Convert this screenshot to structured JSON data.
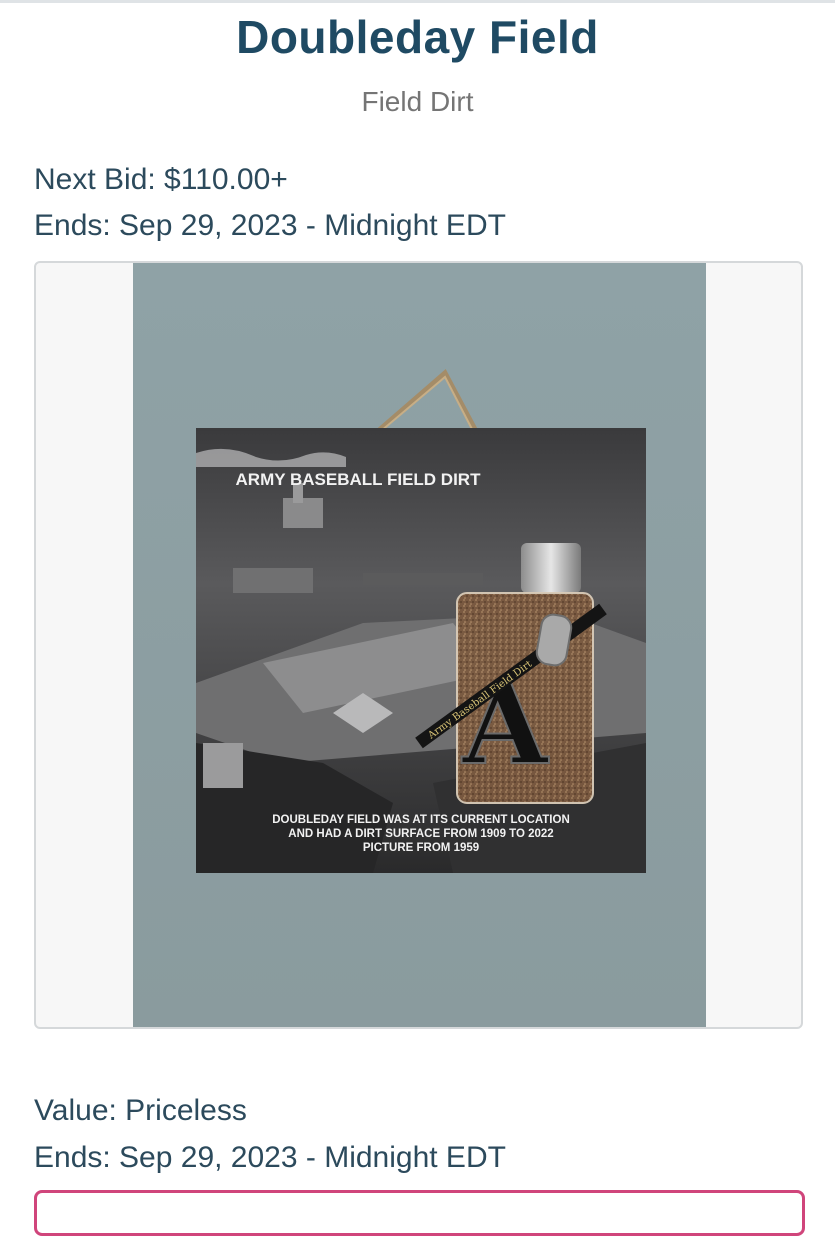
{
  "item": {
    "title": "Doubleday Field",
    "subtitle": "Field Dirt",
    "next_bid": "Next Bid: $110.00+",
    "ends_top": "Ends: Sep 29, 2023 - Midnight EDT",
    "value": "Value: Priceless",
    "ends_bottom": "Ends: Sep 29, 2023 - Midnight EDT"
  },
  "photo": {
    "plaque_title": "ARMY BASEBALL FIELD DIRT",
    "caption_line1": "DOUBLEDAY FIELD WAS AT ITS CURRENT LOCATION",
    "caption_line2": "AND HAD A DIRT SURFACE FROM 1909 TO 2022",
    "caption_line3": "PICTURE FROM 1959",
    "ribbon_text": "Army Baseball Field Dirt",
    "bottle_letter": "A"
  },
  "colors": {
    "title": "#1f4a63",
    "text": "#2c4a5c",
    "wall": "#8c9ea1",
    "accent_border": "#d0457b"
  }
}
